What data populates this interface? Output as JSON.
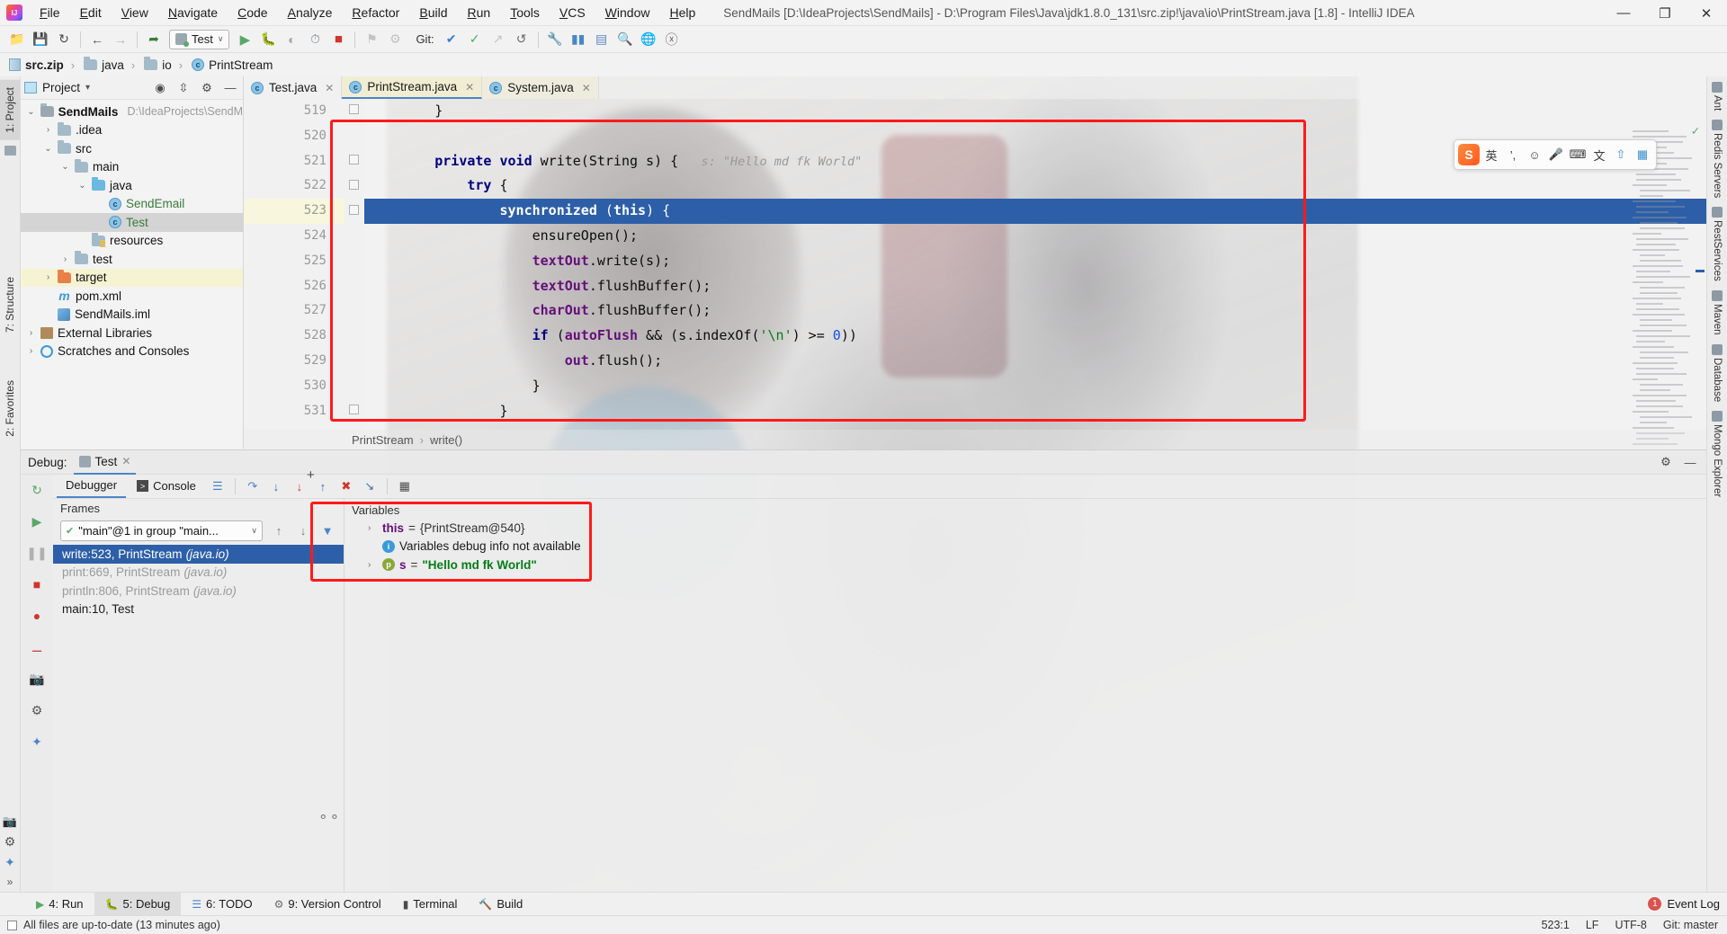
{
  "titlebar": {
    "app_icon": "intellij-logo",
    "menus": [
      "File",
      "Edit",
      "View",
      "Navigate",
      "Code",
      "Analyze",
      "Refactor",
      "Build",
      "Run",
      "Tools",
      "VCS",
      "Window",
      "Help"
    ],
    "window_title": "SendMails [D:\\IdeaProjects\\SendMails] - D:\\Program Files\\Java\\jdk1.8.0_131\\src.zip!\\java\\io\\PrintStream.java [1.8] - IntelliJ IDEA",
    "minimize": "—",
    "maximize": "❐",
    "close": "✕"
  },
  "toolbar": {
    "icons": [
      "open-folder-icon",
      "save-icon",
      "sync-icon",
      "back-arrow-icon",
      "forward-arrow-icon",
      "build-hammer-icon"
    ],
    "run_config_label": "Test",
    "run_config_caret": "∨",
    "run_icon": "run-play-icon",
    "debug_icon": "debug-bug-icon",
    "coverage_icon": "run-coverage-icon",
    "profile_icon": "run-profile-icon",
    "stop_icon": "stop-icon",
    "git_label": "Git:",
    "git_icons": [
      "update-project-icon",
      "commit-check-icon",
      "push-icon",
      "history-icon"
    ],
    "extra_icons": [
      "wrench-icon",
      "terminal-icon",
      "browser-icon",
      "search-icon",
      "translate-icon",
      "no-entry-icon"
    ]
  },
  "breadcrumb": {
    "items": [
      {
        "label": "src.zip",
        "icon": "zip-icon",
        "bold": true
      },
      {
        "label": "java",
        "icon": "folder-icon",
        "bold": false
      },
      {
        "label": "io",
        "icon": "folder-icon",
        "bold": false
      },
      {
        "label": "PrintStream",
        "icon": "class-icon",
        "bold": false
      }
    ],
    "separator": "›"
  },
  "left_strip": {
    "project_tab": "1: Project",
    "structure_tab": "7: Structure",
    "favorites_tab": "2: Favorites",
    "bottom_icons": [
      "screenshot-icon",
      "settings-gear-icon",
      "star-icon",
      "expand-icon"
    ]
  },
  "right_strip": {
    "tabs": [
      "Ant",
      "Redis Servers",
      "RestServices",
      "Maven",
      "Database",
      "Mongo Explorer"
    ]
  },
  "project_panel": {
    "title": "Project",
    "caret": "▾",
    "header_icons": [
      "locate-target-icon",
      "collapse-all-icon",
      "settings-gear-icon",
      "hide-panel-icon"
    ],
    "tree": [
      {
        "label": "SendMails",
        "path": "D:\\IdeaProjects\\SendM",
        "indent": 0,
        "arrow": "down",
        "icon": "project-folder-icon",
        "bold": true,
        "selected": false,
        "highlight": false
      },
      {
        "label": ".idea",
        "path": "",
        "indent": 1,
        "arrow": "right",
        "icon": "folder-icon",
        "bold": false,
        "selected": false,
        "highlight": false
      },
      {
        "label": "src",
        "path": "",
        "indent": 1,
        "arrow": "down",
        "icon": "folder-icon",
        "bold": false,
        "selected": false,
        "highlight": false
      },
      {
        "label": "main",
        "path": "",
        "indent": 2,
        "arrow": "down",
        "icon": "folder-icon",
        "bold": false,
        "selected": false,
        "highlight": false
      },
      {
        "label": "java",
        "path": "",
        "indent": 3,
        "arrow": "down",
        "icon": "source-folder-icon",
        "bold": false,
        "selected": false,
        "highlight": false
      },
      {
        "label": "SendEmail",
        "path": "",
        "indent": 4,
        "arrow": "none",
        "icon": "class-icon",
        "bold": false,
        "selected": false,
        "highlight": false,
        "green": true
      },
      {
        "label": "Test",
        "path": "",
        "indent": 4,
        "arrow": "none",
        "icon": "class-icon",
        "bold": false,
        "selected": true,
        "highlight": false,
        "green": true
      },
      {
        "label": "resources",
        "path": "",
        "indent": 3,
        "arrow": "none",
        "icon": "resources-folder-icon",
        "bold": false,
        "selected": false,
        "highlight": false
      },
      {
        "label": "test",
        "path": "",
        "indent": 2,
        "arrow": "right",
        "icon": "folder-icon",
        "bold": false,
        "selected": false,
        "highlight": false
      },
      {
        "label": "target",
        "path": "",
        "indent": 1,
        "arrow": "right",
        "icon": "target-folder-icon",
        "bold": false,
        "selected": false,
        "highlight": true
      },
      {
        "label": "pom.xml",
        "path": "",
        "indent": 1,
        "arrow": "none",
        "icon": "maven-pom-icon",
        "bold": false,
        "selected": false,
        "highlight": false
      },
      {
        "label": "SendMails.iml",
        "path": "",
        "indent": 1,
        "arrow": "none",
        "icon": "iml-module-icon",
        "bold": false,
        "selected": false,
        "highlight": false
      },
      {
        "label": "External Libraries",
        "path": "",
        "indent": 0,
        "arrow": "right",
        "icon": "library-icon",
        "bold": false,
        "selected": false,
        "highlight": false
      },
      {
        "label": "Scratches and Consoles",
        "path": "",
        "indent": 0,
        "arrow": "right",
        "icon": "scratch-icon",
        "bold": false,
        "selected": false,
        "highlight": false
      }
    ]
  },
  "editor": {
    "tabs": [
      {
        "label": "Test.java",
        "icon": "java-class-icon",
        "active": false,
        "close": "✕"
      },
      {
        "label": "PrintStream.java",
        "icon": "java-class-icon",
        "active": true,
        "close": "✕"
      },
      {
        "label": "System.java",
        "icon": "java-class-icon",
        "active": false,
        "close": "✕"
      }
    ],
    "line_numbers": [
      "519",
      "520",
      "521",
      "522",
      "523",
      "524",
      "525",
      "526",
      "527",
      "528",
      "529",
      "530",
      "531"
    ],
    "current_line": "523",
    "lines": [
      {
        "n": "519",
        "indent": 2,
        "tokens": [
          {
            "t": "}",
            "c": "ident"
          }
        ]
      },
      {
        "n": "520",
        "indent": 0,
        "tokens": []
      },
      {
        "n": "521",
        "indent": 2,
        "tokens": [
          {
            "t": "private",
            "c": "kw"
          },
          {
            "t": " ",
            "c": "ident"
          },
          {
            "t": "void",
            "c": "kw"
          },
          {
            "t": " write(String s) { ",
            "c": "ident"
          },
          {
            "t": "  s: \"Hello md fk World\"",
            "c": "hint"
          }
        ]
      },
      {
        "n": "522",
        "indent": 3,
        "tokens": [
          {
            "t": "try",
            "c": "kw"
          },
          {
            "t": " {",
            "c": "ident"
          }
        ]
      },
      {
        "n": "523",
        "indent": 4,
        "tokens": [
          {
            "t": "synchronized",
            "c": "kw"
          },
          {
            "t": " (",
            "c": "ident"
          },
          {
            "t": "this",
            "c": "kw"
          },
          {
            "t": ") {",
            "c": "ident"
          }
        ]
      },
      {
        "n": "524",
        "indent": 5,
        "tokens": [
          {
            "t": "ensureOpen();",
            "c": "ident"
          }
        ]
      },
      {
        "n": "525",
        "indent": 5,
        "tokens": [
          {
            "t": "textOut",
            "c": "fld"
          },
          {
            "t": ".write(s);",
            "c": "ident"
          }
        ]
      },
      {
        "n": "526",
        "indent": 5,
        "tokens": [
          {
            "t": "textOut",
            "c": "fld"
          },
          {
            "t": ".flushBuffer();",
            "c": "ident"
          }
        ]
      },
      {
        "n": "527",
        "indent": 5,
        "tokens": [
          {
            "t": "charOut",
            "c": "fld"
          },
          {
            "t": ".flushBuffer();",
            "c": "ident"
          }
        ]
      },
      {
        "n": "528",
        "indent": 5,
        "tokens": [
          {
            "t": "if",
            "c": "kw"
          },
          {
            "t": " (",
            "c": "ident"
          },
          {
            "t": "autoFlush",
            "c": "fld"
          },
          {
            "t": " && (s.indexOf(",
            "c": "ident"
          },
          {
            "t": "'\\n'",
            "c": "str"
          },
          {
            "t": ") >= ",
            "c": "ident"
          },
          {
            "t": "0",
            "c": "num"
          },
          {
            "t": "))",
            "c": "ident"
          }
        ]
      },
      {
        "n": "529",
        "indent": 6,
        "tokens": [
          {
            "t": "out",
            "c": "fld"
          },
          {
            "t": ".flush();",
            "c": "ident"
          }
        ]
      },
      {
        "n": "530",
        "indent": 5,
        "tokens": [
          {
            "t": "}",
            "c": "ident"
          }
        ]
      },
      {
        "n": "531",
        "indent": 4,
        "tokens": [
          {
            "t": "}",
            "c": "ident"
          }
        ]
      }
    ],
    "breadcrumb_class": "PrintStream",
    "breadcrumb_method": "write()",
    "breadcrumb_sep": "›",
    "inspection_ok_icon": "✓"
  },
  "ime": {
    "logo": "S",
    "mode_label": "英",
    "punct_label": "’,",
    "icons": [
      "emoji-icon",
      "microphone-icon",
      "keyboard-icon",
      "translate-icon",
      "upload-icon",
      "apps-icon"
    ]
  },
  "debug": {
    "panel_label": "Debug:",
    "session_name": "Test",
    "session_close": "✕",
    "settings_icon": "settings-gear-icon",
    "hide_icon": "hide-panel-icon",
    "restore_icon": "restore-layout-icon",
    "tabs": [
      {
        "label": "Debugger",
        "icon": "",
        "active": true
      },
      {
        "label": "Console",
        "icon": "console-icon",
        "active": false
      }
    ],
    "toolbar_icons": [
      "frames-icon",
      "step-over-icon",
      "step-into-icon",
      "force-step-into-icon",
      "step-out-icon",
      "drop-frame-icon",
      "run-to-cursor-icon",
      "evaluate-expression-icon"
    ],
    "side_icons": [
      "rerun-icon",
      "resume-icon",
      "pause-icon",
      "stop-icon",
      "mute-breakpoints-icon",
      "view-breakpoints-icon",
      "settings-icon"
    ],
    "frames_header": "Frames",
    "thread_selector": "\"main\"@1 in group \"main...",
    "thread_caret": "∨",
    "frames_tool_icons": [
      "up-arrow-icon",
      "down-arrow-icon",
      "filter-icon"
    ],
    "frames": [
      {
        "label": "write:523, PrintStream",
        "file": "(java.io)",
        "selected": true,
        "dim": false
      },
      {
        "label": "print:669, PrintStream",
        "file": "(java.io)",
        "selected": false,
        "dim": true
      },
      {
        "label": "println:806, PrintStream",
        "file": "(java.io)",
        "selected": false,
        "dim": true
      },
      {
        "label": "main:10, Test",
        "file": "",
        "selected": false,
        "dim": false
      }
    ],
    "variables_header": "Variables",
    "variables_add": "+",
    "variables": [
      {
        "arrow": "›",
        "badge": "",
        "name": "this",
        "eq": "=",
        "value": "{PrintStream@540}",
        "kind": "object"
      },
      {
        "arrow": "",
        "badge": "i",
        "name": "",
        "eq": "",
        "value": "Variables debug info not available",
        "kind": "info"
      },
      {
        "arrow": "›",
        "badge": "p",
        "name": "s",
        "eq": "=",
        "value": "\"Hello md fk World\"",
        "kind": "string"
      }
    ],
    "glasses_icon": "watches-icon"
  },
  "bottom_bar": {
    "items": [
      {
        "label": "4: Run",
        "icon": "run-icon",
        "active": false
      },
      {
        "label": "5: Debug",
        "icon": "debug-icon",
        "active": true
      },
      {
        "label": "6: TODO",
        "icon": "todo-icon",
        "active": false
      },
      {
        "label": "9: Version Control",
        "icon": "vcs-icon",
        "active": false
      },
      {
        "label": "Terminal",
        "icon": "terminal-icon",
        "active": false
      },
      {
        "label": "Build",
        "icon": "build-icon",
        "active": false
      }
    ],
    "event_log": "Event Log",
    "event_count": "1"
  },
  "status_bar": {
    "message": "All files are up-to-date (13 minutes ago)",
    "caret_position": "523:1",
    "line_separator": "LF",
    "encoding": "UTF-8",
    "branch": "Git: master"
  },
  "annotations": {
    "code_box_color": "#ff1a1a",
    "variables_box_color": "#ff1a1a"
  }
}
